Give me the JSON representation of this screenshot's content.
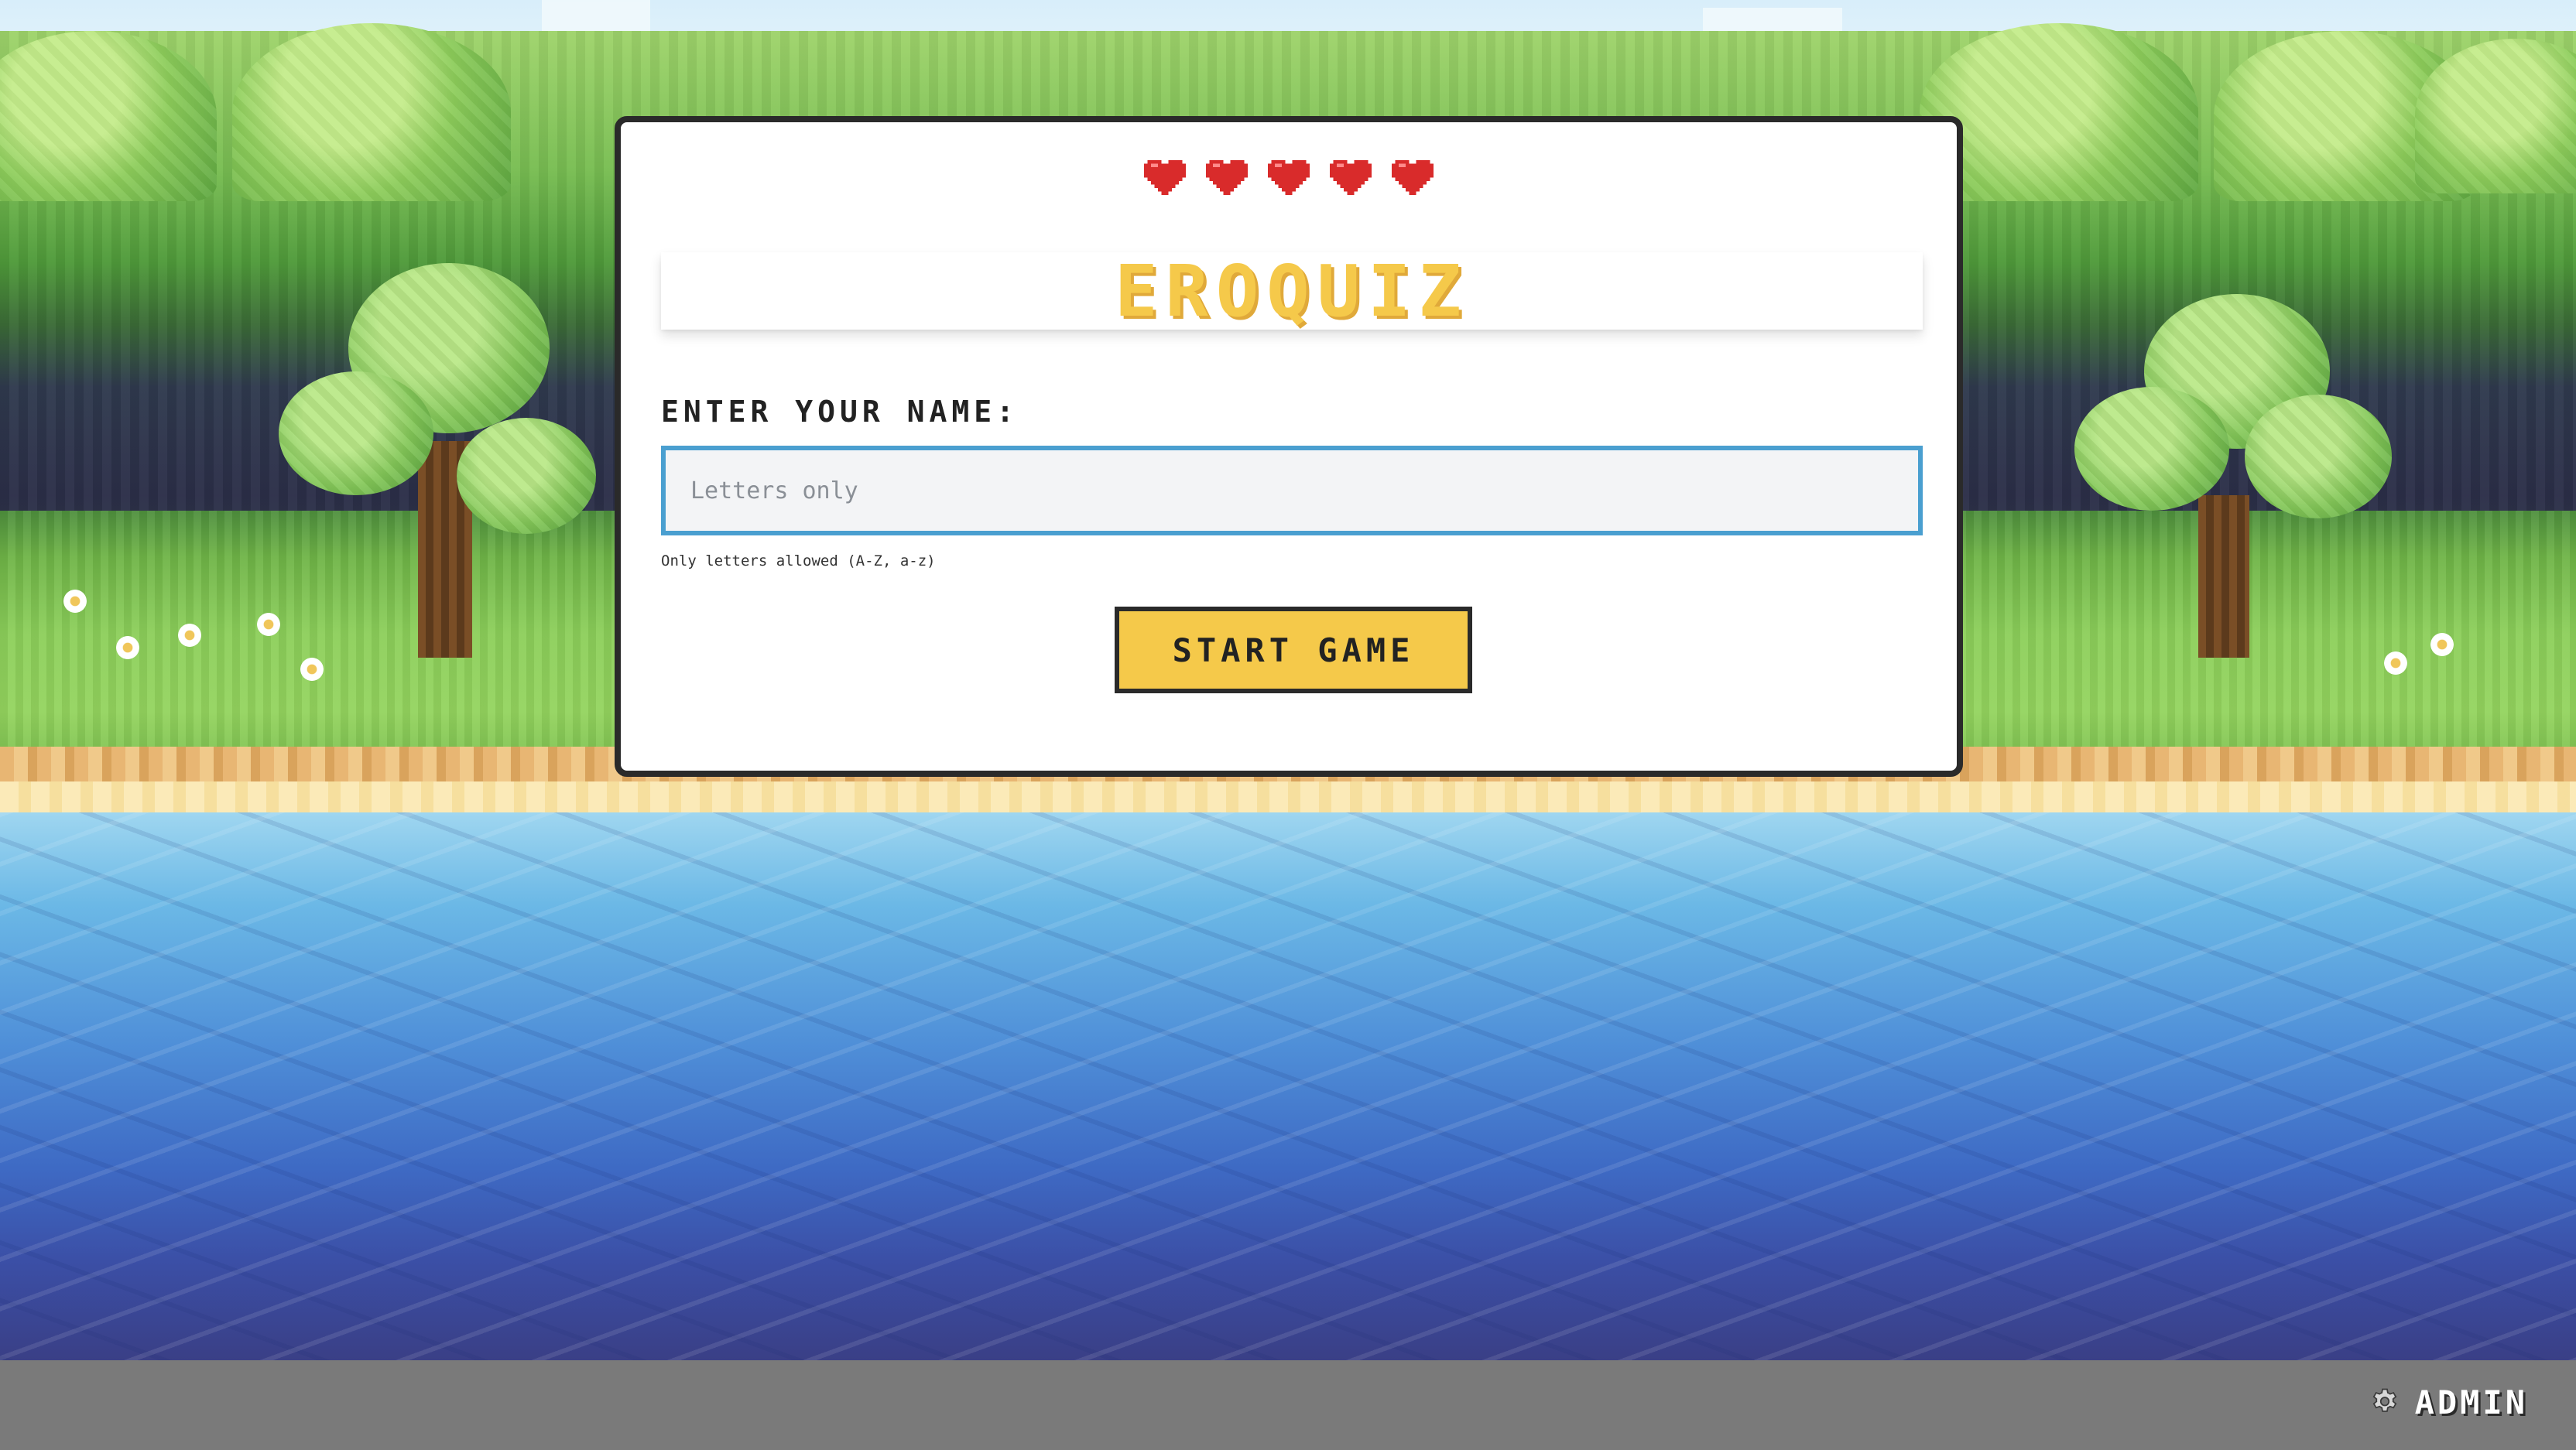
{
  "game": {
    "title": "EROQUIZ",
    "lives": 5
  },
  "form": {
    "name_label": "ENTER YOUR NAME:",
    "name_placeholder": "Letters only",
    "name_value": "",
    "hint": "Only letters allowed (A-Z, a-z)",
    "start_label": "START GAME"
  },
  "footer": {
    "admin_label": "ADMIN",
    "admin_icon": "gear-icon"
  },
  "colors": {
    "accent": "#f5c94a",
    "heart": "#d92b2b",
    "input_border": "#4a9fd0"
  }
}
